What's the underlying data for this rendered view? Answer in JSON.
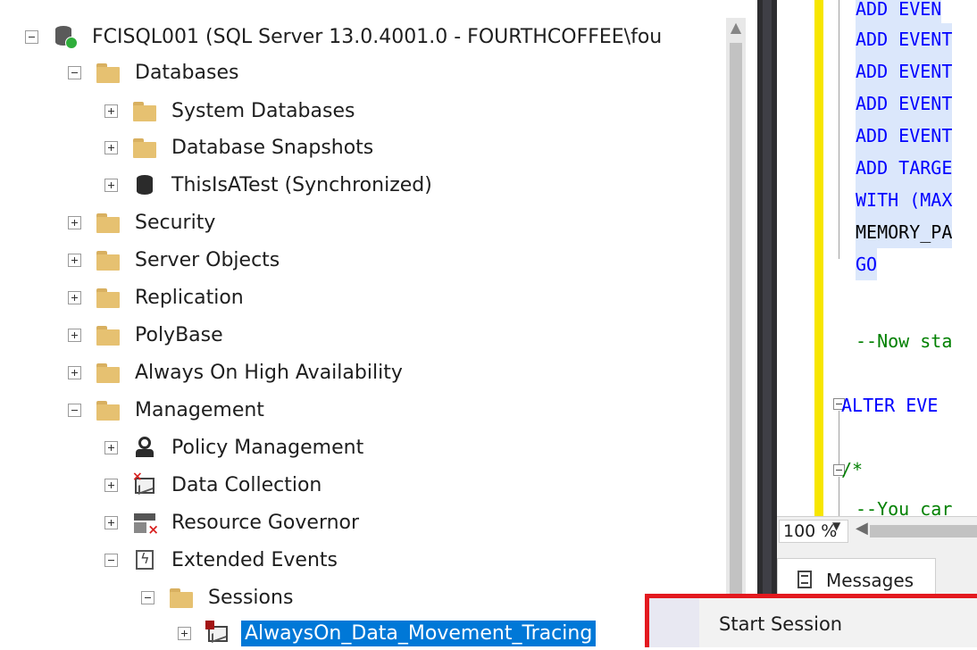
{
  "object_explorer": {
    "server": {
      "label": "FCISQL001 (SQL Server 13.0.4001.0 - FOURTHCOFFEE\\fou",
      "icon": "server-icon",
      "state": "expanded"
    },
    "items": [
      {
        "label": "Databases",
        "icon": "folder-icon",
        "state": "expanded"
      },
      {
        "label": "System Databases",
        "icon": "folder-icon",
        "state": "collapsed"
      },
      {
        "label": "Database Snapshots",
        "icon": "folder-icon",
        "state": "collapsed"
      },
      {
        "label": "ThisIsATest (Synchronized)",
        "icon": "database-icon",
        "state": "collapsed"
      },
      {
        "label": "Security",
        "icon": "folder-icon",
        "state": "collapsed"
      },
      {
        "label": "Server Objects",
        "icon": "folder-icon",
        "state": "collapsed"
      },
      {
        "label": "Replication",
        "icon": "folder-icon",
        "state": "collapsed"
      },
      {
        "label": "PolyBase",
        "icon": "folder-icon",
        "state": "collapsed"
      },
      {
        "label": "Always On High Availability",
        "icon": "folder-icon",
        "state": "collapsed"
      },
      {
        "label": "Management",
        "icon": "folder-icon",
        "state": "expanded"
      },
      {
        "label": "Policy Management",
        "icon": "policy-icon",
        "state": "collapsed"
      },
      {
        "label": "Data Collection",
        "icon": "data-collection-icon",
        "state": "collapsed"
      },
      {
        "label": "Resource Governor",
        "icon": "resource-governor-icon",
        "state": "collapsed"
      },
      {
        "label": "Extended Events",
        "icon": "extended-events-icon",
        "state": "expanded"
      },
      {
        "label": "Sessions",
        "icon": "folder-icon",
        "state": "expanded"
      },
      {
        "label": "AlwaysOn_Data_Movement_Tracing",
        "icon": "session-icon",
        "state": "collapsed",
        "selected": true
      }
    ]
  },
  "editor": {
    "lines": [
      {
        "text": "ADD EVEN",
        "color": "blue"
      },
      {
        "text": "ADD EVENT",
        "color": "blue"
      },
      {
        "text": "ADD EVENT",
        "color": "blue"
      },
      {
        "text": "ADD EVENT",
        "color": "blue"
      },
      {
        "text": "ADD EVENT",
        "color": "blue"
      },
      {
        "text": "ADD TARGE",
        "color": "blue"
      },
      {
        "text": "WITH (MAX",
        "color": "blue"
      },
      {
        "text": "MEMORY_PA",
        "color": "black"
      },
      {
        "text": "GO",
        "color": "blue"
      },
      {
        "text": "--Now sta",
        "color": "green"
      },
      {
        "text": "ALTER EVE",
        "color": "blue"
      },
      {
        "text": "/*",
        "color": "green"
      },
      {
        "text": "--You car",
        "color": "green"
      }
    ],
    "zoom": "100 %"
  },
  "results": {
    "messages_tab_label": "Messages"
  },
  "context_menu": {
    "items": [
      "Start Session"
    ]
  },
  "colors": {
    "selection": "#0078d7",
    "keyword": "#0000ff",
    "comment": "#008000",
    "menu_highlight_border": "#e3191f",
    "change_bar": "#f7e600"
  }
}
